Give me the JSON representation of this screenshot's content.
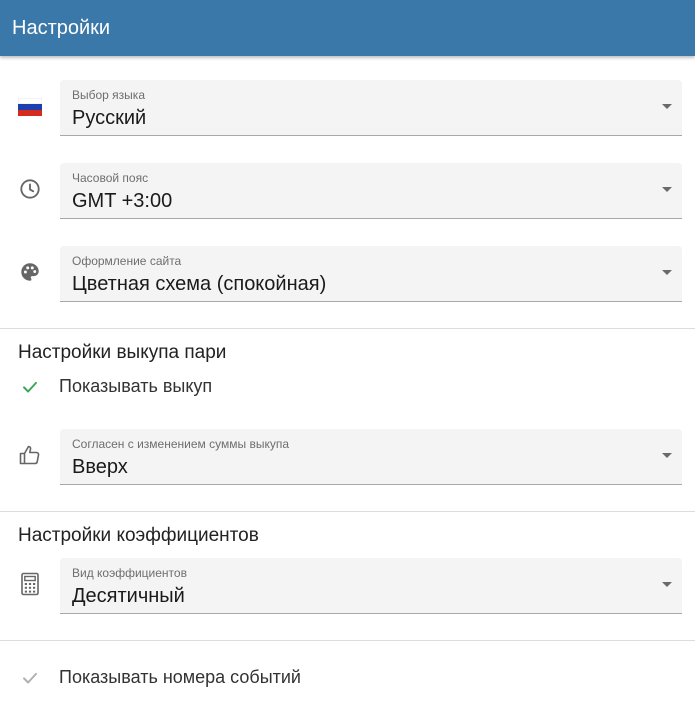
{
  "header": {
    "title": "Настройки",
    "color": "#3a78a9"
  },
  "general": {
    "language": {
      "icon": "russian-flag-icon",
      "label": "Выбор языка",
      "value": "Русский"
    },
    "timezone": {
      "icon": "clock-icon",
      "label": "Часовой пояс",
      "value": "GMT +3:00"
    },
    "theme": {
      "icon": "palette-icon",
      "label": "Оформление сайта",
      "value": "Цветная схема (спокойная)"
    }
  },
  "cashout": {
    "heading": "Настройки выкупа пари",
    "show_cashout": {
      "label": "Показывать выкуп",
      "checked": true,
      "check_color": "#3aa757"
    },
    "accept_change": {
      "icon": "thumbs-up-icon",
      "label": "Согласен с изменением суммы выкупа",
      "value": "Вверх"
    }
  },
  "odds": {
    "heading": "Настройки коэффициентов",
    "format": {
      "icon": "calculator-icon",
      "label": "Вид коэффициентов",
      "value": "Десятичный"
    }
  },
  "events": {
    "show_event_numbers": {
      "label": "Показывать номера событий",
      "checked": false,
      "check_color": "#b0b0b0"
    }
  }
}
